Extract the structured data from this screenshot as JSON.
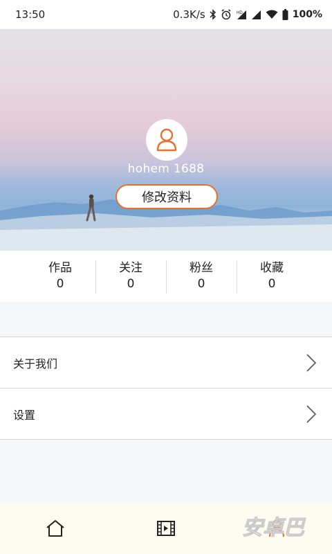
{
  "status_bar": {
    "time": "13:50",
    "net_speed": "0.3K/s",
    "battery": "100%",
    "icons": [
      "bluetooth-icon",
      "alarm-icon",
      "hd-signal-icon",
      "signal-icon",
      "wifi-icon",
      "battery-icon"
    ]
  },
  "profile": {
    "username": "hohem 1688",
    "edit_label": "修改资料",
    "accent": "#e8702a"
  },
  "stats": [
    {
      "label": "作品",
      "value": "0"
    },
    {
      "label": "关注",
      "value": "0"
    },
    {
      "label": "粉丝",
      "value": "0"
    },
    {
      "label": "收藏",
      "value": "0"
    }
  ],
  "menu": [
    {
      "label": "关于我们"
    },
    {
      "label": "设置"
    }
  ],
  "bottom_nav": {
    "tabs": [
      "home-icon",
      "video-icon",
      "profile-icon"
    ],
    "active": "profile-icon"
  },
  "watermark": {
    "text": "安卓巴"
  }
}
